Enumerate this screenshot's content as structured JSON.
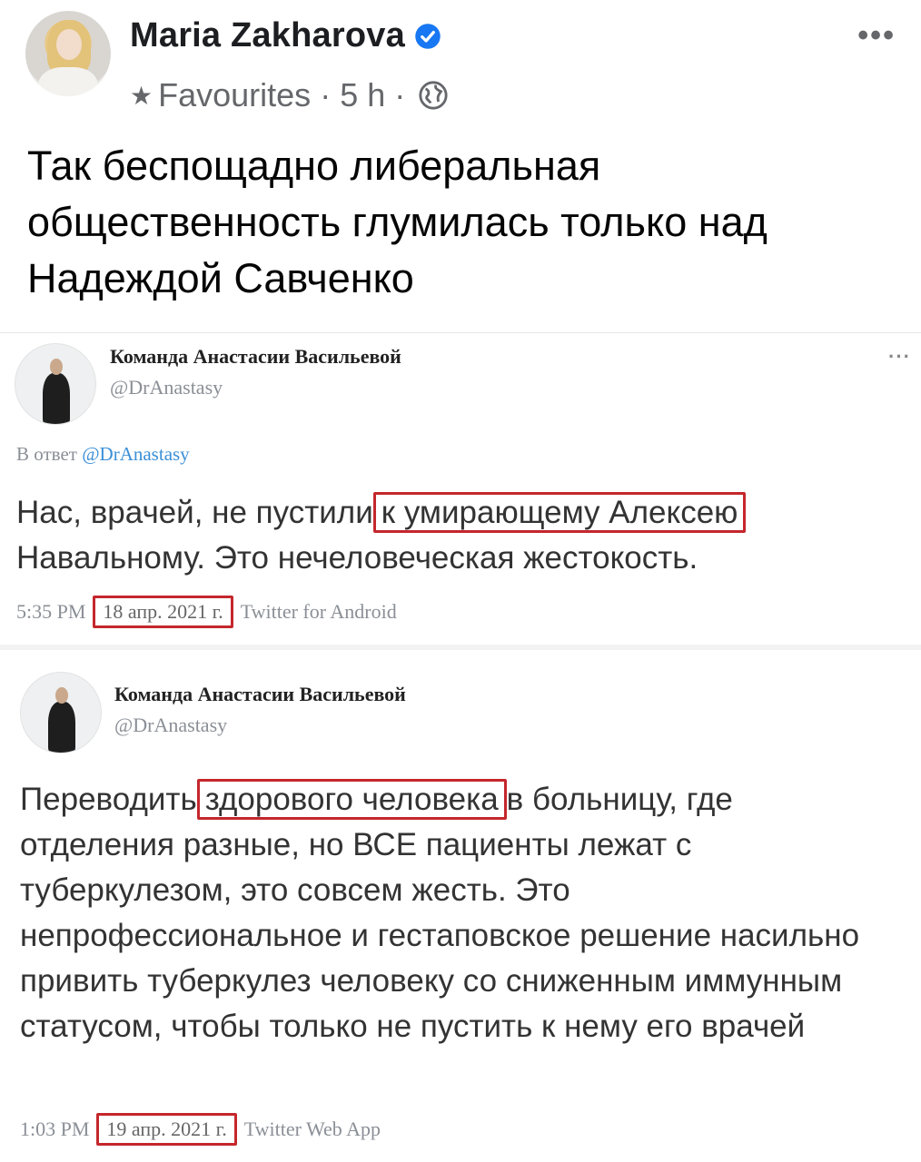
{
  "post": {
    "author_name": "Maria Zakharova",
    "audience": "Favourites",
    "time": "5 h",
    "separator": "·",
    "text": "Так беспощадно либеральная общественность  глумилась только  над Надеждой Савченко",
    "icons": {
      "verified": "verified-badge-icon",
      "star": "star-icon",
      "globe": "globe-icon",
      "more": "more-options-icon"
    },
    "accent_color": "#1877f2"
  },
  "tweets": [
    {
      "name": "Команда Анастасии Васильевой",
      "handle": "@DrAnastasy",
      "reply_prefix": "В ответ",
      "reply_mention": "@DrAnastasy",
      "text_before": "Нас, врачей, не пустили",
      "text_highlight": "к умирающему Алексею",
      "text_after": "Навальному. Это нечеловеческая жестокость.",
      "time": "5:35 PM",
      "date": "18 апр. 2021 г.",
      "client": "Twitter for Android"
    },
    {
      "name": "Команда Анастасии Васильевой",
      "handle": "@DrAnastasy",
      "text_before": "Переводить",
      "text_highlight": "здорового человека",
      "text_after": "в больницу, где отделения разные, но ВСЕ пациенты лежат с туберкулезом, это совсем жесть. Это непрофессиональное и гестаповское решение насильно привить туберкулез человеку со сниженным иммунным статусом, чтобы только не пустить к нему его врачей",
      "time": "1:03 PM",
      "date": "19 апр. 2021 г.",
      "client": "Twitter Web App"
    }
  ],
  "highlight_color": "#c4272c"
}
